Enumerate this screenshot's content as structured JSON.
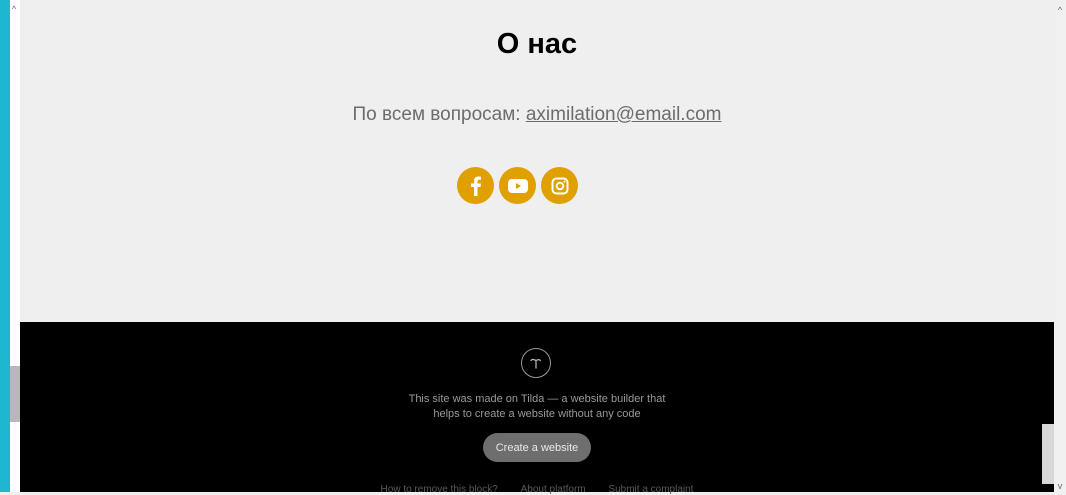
{
  "section": {
    "title": "О нас",
    "contact_prefix": "По всем вопросам: ",
    "contact_email": "aximilation@email.com"
  },
  "social": [
    {
      "name": "facebook",
      "icon": "facebook-icon"
    },
    {
      "name": "youtube",
      "icon": "youtube-icon"
    },
    {
      "name": "instagram",
      "icon": "instagram-icon"
    }
  ],
  "footer": {
    "text_line1": "This site was made on Tilda — a website builder that",
    "text_line2": "helps to create a website without any code",
    "create_button": "Create a website",
    "links": [
      "How to remove this block?",
      "About platform",
      "Submit a complaint"
    ]
  },
  "colors": {
    "accent": "#e0a000",
    "left_bar": "#1eb6d1",
    "footer_bg": "#000000",
    "page_bg": "#efefef"
  }
}
